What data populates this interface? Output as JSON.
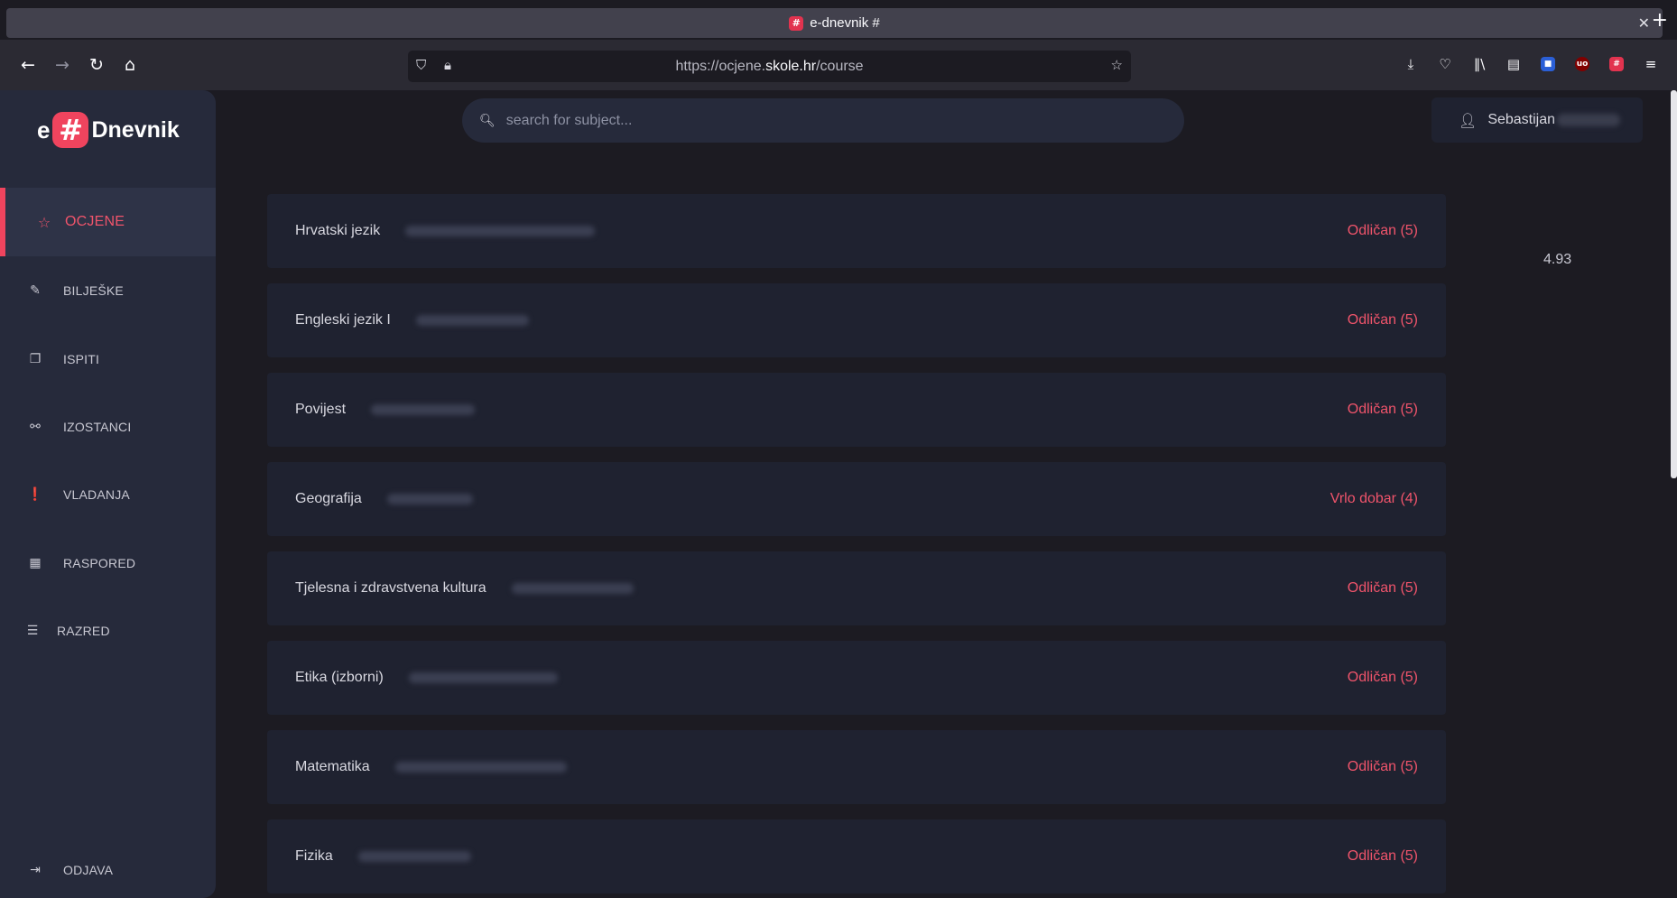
{
  "browser": {
    "tab_title": "e-dnevnik #",
    "tab_favicon": "#",
    "close_glyph": "✕",
    "newtab_glyph": "+",
    "url_prefix": "https://ocjene.",
    "url_domain": "skole.hr",
    "url_path": "/course"
  },
  "sidebar": {
    "logo_e": "e",
    "logo_hash": "#",
    "logo_text": "Dnevnik",
    "items": [
      {
        "label": "OCJENE",
        "icon": "star-icon",
        "glyph": "☆"
      },
      {
        "label": "BILJEŠKE",
        "icon": "edit-icon",
        "glyph": "✎"
      },
      {
        "label": "ISPITI",
        "icon": "copy-icon",
        "glyph": "❐"
      },
      {
        "label": "IZOSTANCI",
        "icon": "unlink-icon",
        "glyph": "⚯"
      },
      {
        "label": "VLADANJA",
        "icon": "exclamation-icon",
        "glyph": "❗"
      },
      {
        "label": "RASPORED",
        "icon": "calendar-icon",
        "glyph": "▦"
      },
      {
        "label": "RAZRED",
        "icon": "list-icon",
        "glyph": "☰"
      }
    ],
    "logout_label": "ODJAVA",
    "logout_glyph": "⇥"
  },
  "search": {
    "placeholder": "search for subject..."
  },
  "user": {
    "first_name": "Sebastijan"
  },
  "courses": [
    {
      "name": "Hrvatski jezik",
      "grade": "Odličan (5)"
    },
    {
      "name": "Engleski jezik I",
      "grade": "Odličan (5)"
    },
    {
      "name": "Povijest",
      "grade": "Odličan (5)"
    },
    {
      "name": "Geografija",
      "grade": "Vrlo dobar (4)"
    },
    {
      "name": "Tjelesna i zdravstvena kultura",
      "grade": "Odličan (5)"
    },
    {
      "name": "Etika (izborni)",
      "grade": "Odličan (5)"
    },
    {
      "name": "Matematika",
      "grade": "Odličan (5)"
    },
    {
      "name": "Fizika",
      "grade": "Odličan (5)"
    }
  ],
  "average": "4.93",
  "colors": {
    "accent": "#f0445e",
    "sidebar_bg": "#262a3b",
    "card_bg": "#1f2230",
    "page_bg": "#1c1b22"
  }
}
